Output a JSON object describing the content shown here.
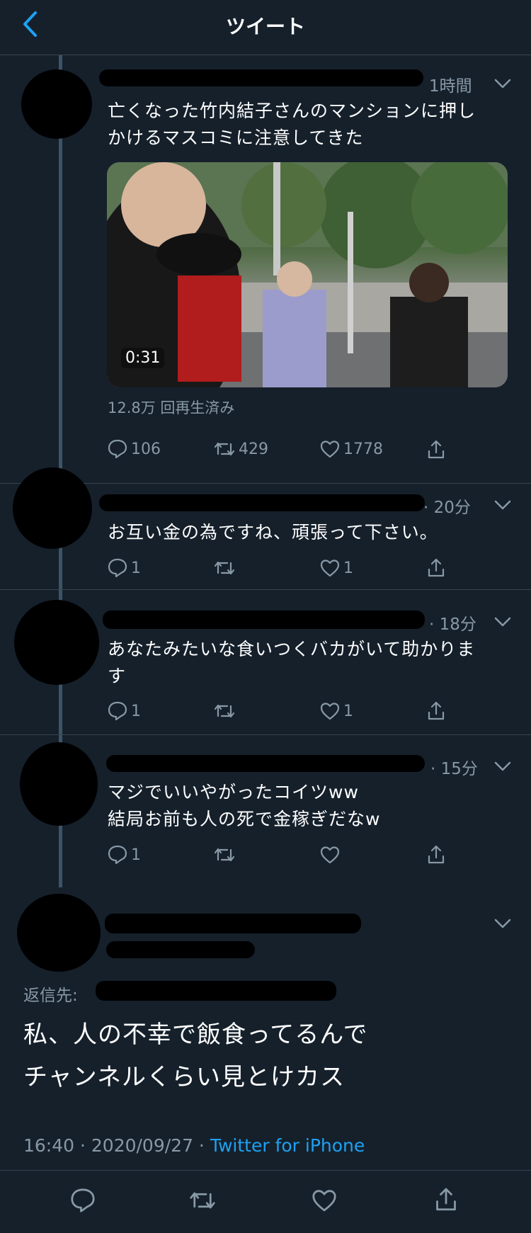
{
  "header": {
    "title": "ツイート"
  },
  "original": {
    "time": "1時間",
    "text_lines": [
      "亡くなった竹内結子さんのマンションに押し",
      "かけるマスコミに注意してきた"
    ],
    "video": {
      "duration": "0:31",
      "views": "12.8万 回再生済み"
    },
    "actions": {
      "replies": "106",
      "retweets": "429",
      "likes": "1778"
    }
  },
  "replies": [
    {
      "time": "· 20分",
      "text_lines": [
        "お互い金の為ですね、頑張って下さい。"
      ],
      "replies": "1",
      "likes": "1"
    },
    {
      "time": "· 18分",
      "text_lines": [
        "あなたみたいな食いつくバカがいて助かりま",
        "す"
      ],
      "replies": "1",
      "likes": "1"
    },
    {
      "time": "· 15分",
      "text_lines": [
        "マジでいいやがったコイツww",
        "結局お前も人の死で金稼ぎだなw"
      ],
      "replies": "1",
      "likes": ""
    }
  ],
  "focused": {
    "reply_to_label": "返信先:",
    "text_lines": [
      "私、人の不幸で飯食ってるんで",
      "チャンネルくらい見とけカス"
    ],
    "time": "16:40",
    "date": "2020/09/27",
    "source": "Twitter for iPhone"
  },
  "colors": {
    "background": "#15202b",
    "accent": "#1da1f2",
    "muted": "#8899a6",
    "divider": "#38444d"
  }
}
